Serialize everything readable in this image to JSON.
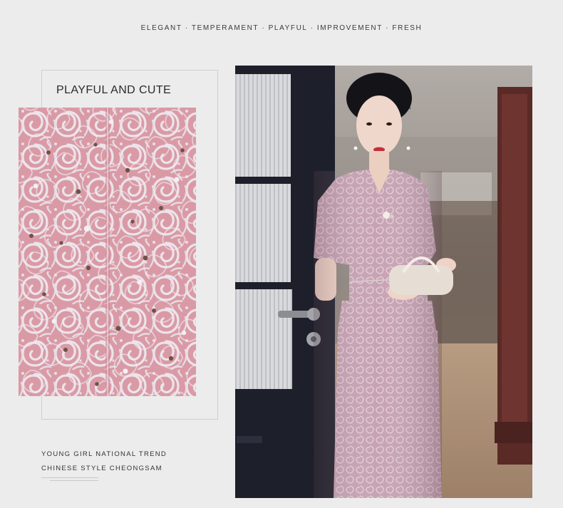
{
  "header": {
    "tagline": "ELEGANT · TEMPERAMENT · PLAYFUL · IMPROVEMENT · FRESH"
  },
  "detail": {
    "heading": "PLAYFUL AND CUTE",
    "image": "pink-lace-fabric-closeup"
  },
  "caption": {
    "line1": "YOUNG GIRL NATIONAL TREND",
    "line2": "CHINESE STYLE CHEONGSAM"
  },
  "main_image": "model-in-pink-lace-dress",
  "colors": {
    "background": "#ececec",
    "lace_pink": "#d99aa6",
    "dress_pink": "#c7a2b3",
    "door_dark": "#1d1f2a"
  }
}
